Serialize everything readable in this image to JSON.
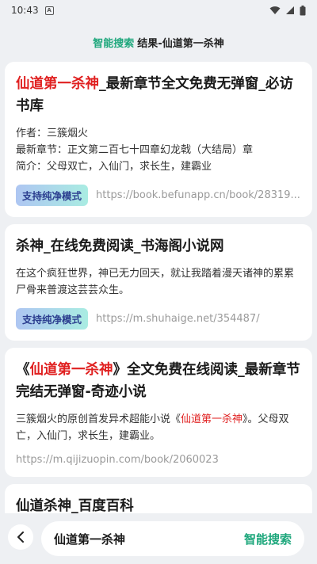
{
  "status_bar": {
    "time": "10:43",
    "app_letter": "A"
  },
  "header": {
    "brand": "智能搜索",
    "subtitle": "结果-仙道第一杀神"
  },
  "results": [
    {
      "title_hl": "仙道第一杀神",
      "title_rest": "_最新章节全文免费无弹窗_必访书库",
      "lines": [
        "作者：三簇烟火",
        "最新章节：正文第二百七十四章幻龙戟（大结局）章",
        "简介：父母双亡，入仙门，求长生，建霸业"
      ],
      "badge": "支持纯净模式",
      "url": "https://book.befunapp.cn/book/28319..."
    },
    {
      "title": "杀神_在线免费阅读_书海阁小说网",
      "body": "在这个疯狂世界，神已无力回天，就让我踏着漫天诸神的累累尸骨来普渡这芸芸众生。",
      "badge": "支持纯净模式",
      "url": "https://m.shuhaige.net/354487/"
    },
    {
      "title_pre": "《",
      "title_hl": "仙道第一杀神",
      "title_rest": "》全文免费在线阅读_最新章节完结无弹窗-奇迹小说",
      "body_pre": "三簇烟火的原创首发异术超能小说《",
      "body_hl": "仙道第一杀神",
      "body_rest": "》。父母双亡，入仙门，求长生，建霸业。",
      "url": "https://m.qijizuopin.com/book/2060023"
    },
    {
      "title": "仙道杀神_百度百科"
    }
  ],
  "search": {
    "value": "仙道第一杀神",
    "button": "智能搜索"
  }
}
